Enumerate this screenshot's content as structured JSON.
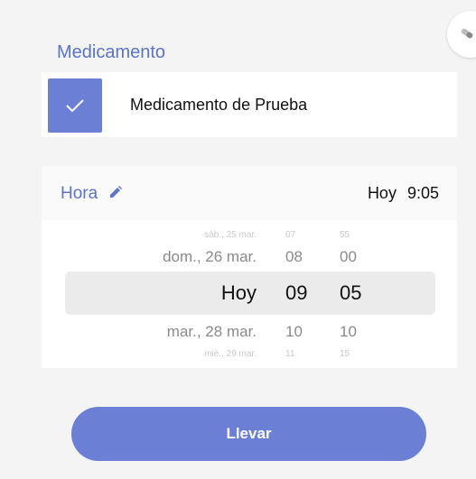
{
  "section": {
    "title": "Medicamento"
  },
  "medication": {
    "checked": true,
    "name": "Medicamento de Prueba"
  },
  "time": {
    "label": "Hora",
    "day": "Hoy",
    "value": "9:05"
  },
  "picker": {
    "rows": [
      {
        "day": "sáb., 25 mar.",
        "hour": "07",
        "minute": "55"
      },
      {
        "day": "dom., 26 mar.",
        "hour": "08",
        "minute": "00"
      },
      {
        "day": "Hoy",
        "hour": "09",
        "minute": "05"
      },
      {
        "day": "mar., 28 mar.",
        "hour": "10",
        "minute": "10"
      },
      {
        "day": "mié., 29 mar.",
        "hour": "11",
        "minute": "15"
      }
    ]
  },
  "actions": {
    "primary_label": "Llevar"
  },
  "colors": {
    "accent": "#6b7fd4",
    "title": "#5c73c6"
  },
  "icons": {
    "corner": "pill-icon",
    "check": "check-icon",
    "edit": "pencil-icon"
  }
}
